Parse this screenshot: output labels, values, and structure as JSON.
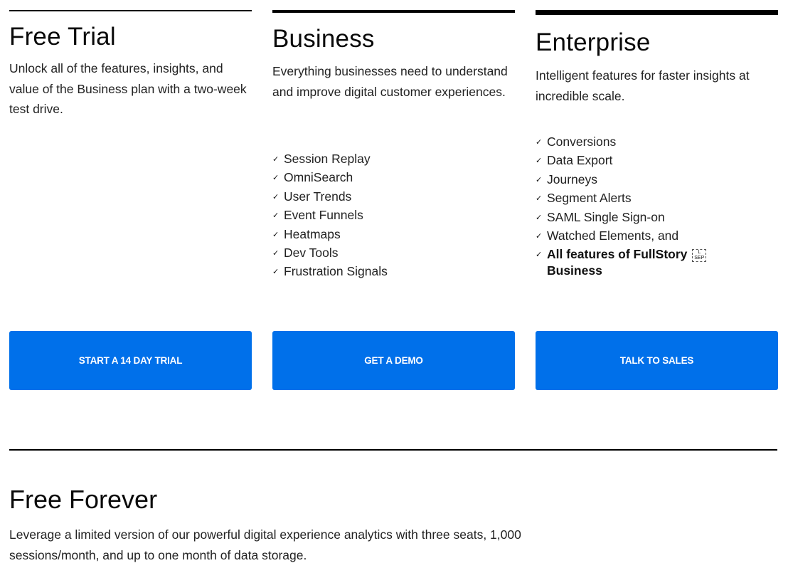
{
  "plans": [
    {
      "id": "free-trial",
      "title": "Free Trial",
      "description": "Unlock all of the features, insights, and value of the Business plan with a two-week test drive.",
      "features": [],
      "cta_label": "START A 14 DAY TRIAL"
    },
    {
      "id": "business",
      "title": "Business",
      "description": "Everything businesses need to understand and improve digital customer experiences.",
      "features": [
        "Session Replay",
        "OmniSearch",
        "User Trends",
        "Event Funnels",
        "Heatmaps",
        "Dev Tools",
        "Frustration Signals"
      ],
      "cta_label": "GET A DEMO"
    },
    {
      "id": "enterprise",
      "title": "Enterprise",
      "description": "Intelligent features for faster insights at incredible scale.",
      "features": [
        "Conversions",
        "Data Export",
        "Journeys",
        "Segment Alerts",
        "SAML Single Sign-on",
        "Watched Elements, and"
      ],
      "highlight_feature": "All features of FullStory Business",
      "highlight_feature_line1": "All features of FullStory",
      "highlight_feature_line2": "Business",
      "separator_glyph_label": "L SEP",
      "cta_label": "TALK TO SALES"
    }
  ],
  "check_glyph": "✓",
  "free_forever": {
    "title": "Free Forever",
    "description": "Leverage a limited version of our powerful digital experience analytics with three seats, 1,000 sessions/month, and up to one month of data storage."
  },
  "colors": {
    "cta_background": "#0070ea",
    "cta_text": "#ffffff",
    "rule": "#000000"
  }
}
